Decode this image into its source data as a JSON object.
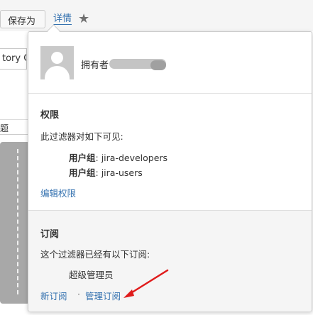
{
  "toolbar": {
    "save_as_label": "保存为",
    "details_label": "详情",
    "star_icon": "★"
  },
  "background": {
    "dropdown_text": "tory O",
    "column_header_fragment": "题"
  },
  "popup": {
    "owner_label": "拥有者",
    "permissions": {
      "title": "权限",
      "description": "此过滤器对如下可见:",
      "groups": [
        {
          "label": "用户组",
          "value": ": jira-developers"
        },
        {
          "label": "用户组",
          "value": ": jira-users"
        }
      ],
      "edit_link": "编辑权限"
    },
    "subscriptions": {
      "title": "订阅",
      "description": "这个过滤器已经有以下订阅:",
      "subscriber": "超级管理员",
      "new_link": "新订阅",
      "separator": "·",
      "manage_link": "管理订阅"
    }
  },
  "colors": {
    "link": "#3572b0",
    "annotation_arrow": "#e01b1b"
  }
}
